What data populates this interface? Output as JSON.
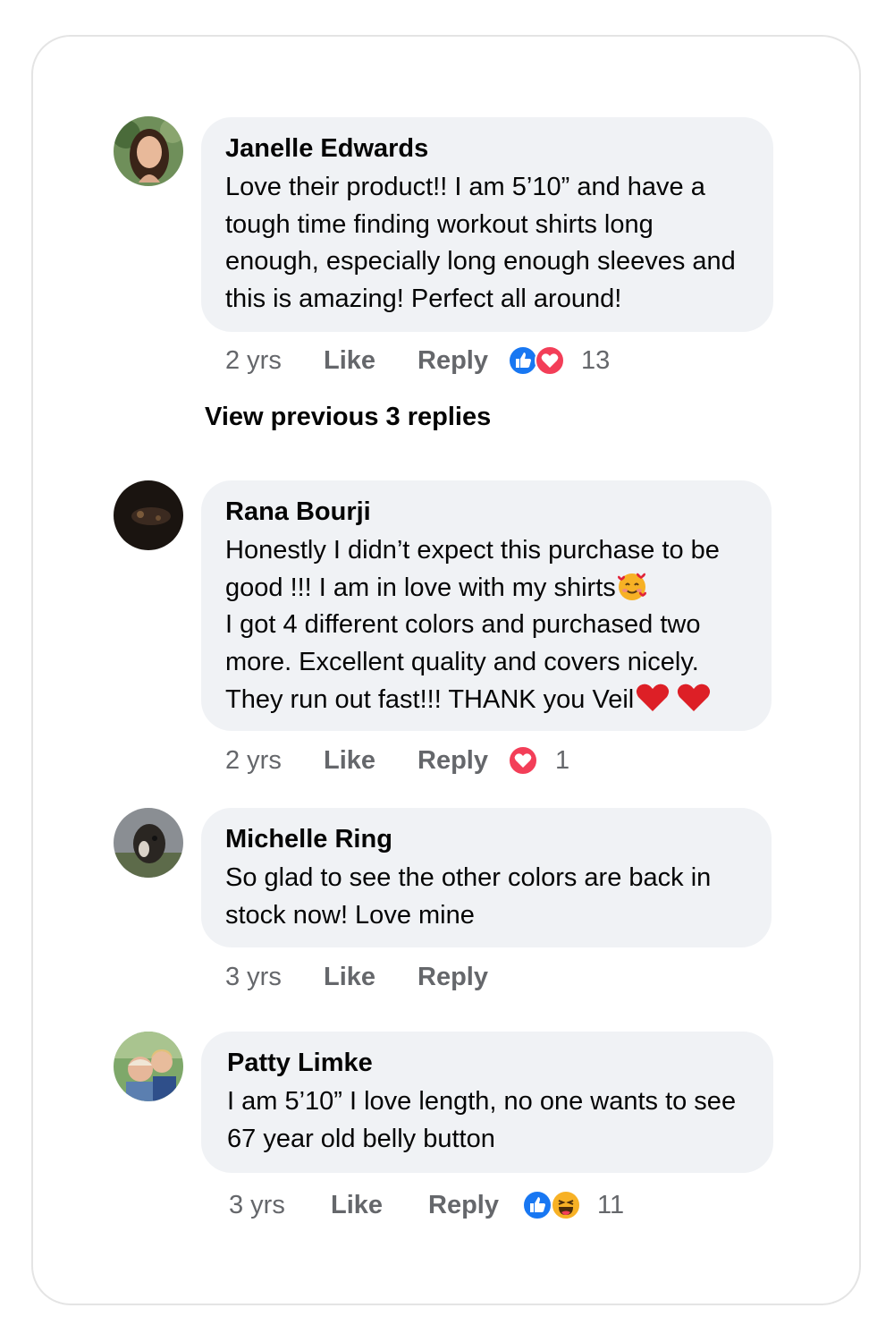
{
  "comments": [
    {
      "author": "Janelle Edwards",
      "text": "Love their product!! I am 5’10” and have a tough time finding workout shirts long enough, especially long enough sleeves and this is amazing! Perfect all around!",
      "time": "2 yrs",
      "like": "Like",
      "reply": "Reply",
      "reactions": [
        "like-icon",
        "love-icon"
      ],
      "reaction_count": "13"
    },
    {
      "author": "Rana Bourji",
      "text_line1": "Honestly I didn’t expect this purchase to be good !!! I am in love with my shirts",
      "text_line2": "I got 4 different colors and purchased two more. Excellent quality and covers nicely. They run out fast!!! THANK you Veil",
      "emojis": [
        "smiling-face-with-hearts-emoji",
        "red-heart-emoji",
        "red-heart-emoji"
      ],
      "time": "2 yrs",
      "like": "Like",
      "reply": "Reply",
      "reactions": [
        "love-icon"
      ],
      "reaction_count": "1"
    },
    {
      "author": "Michelle Ring",
      "text": "So glad to see the other colors are back in stock now!  Love mine",
      "time": "3 yrs",
      "like": "Like",
      "reply": "Reply",
      "reactions": [],
      "reaction_count": ""
    },
    {
      "author": "Patty Limke",
      "text": "I am 5’10” I love length, no one wants to see 67 year old belly button",
      "time": "3 yrs",
      "like": "Like",
      "reply": "Reply",
      "reactions": [
        "like-icon",
        "haha-icon"
      ],
      "reaction_count": "11"
    }
  ],
  "view_previous_replies": "View previous 3 replies",
  "colors": {
    "bubble": "#f0f2f5",
    "text": "#050505",
    "meta": "#65676b",
    "like_blue": "#1877f2",
    "love_red": "#f33e58",
    "haha_yellow": "#f7b125"
  }
}
